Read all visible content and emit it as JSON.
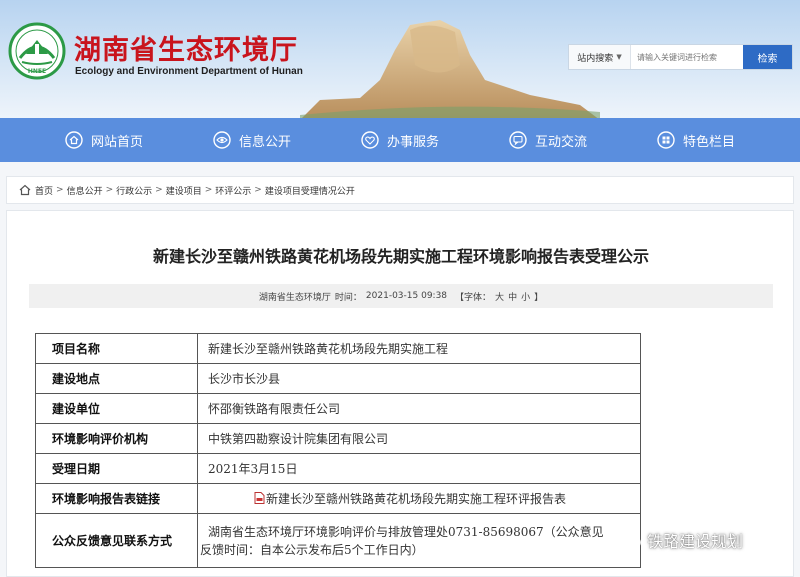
{
  "header": {
    "title": "湖南省生态环境厅",
    "subtitle": "Ecology and Environment Department of Hunan",
    "logo_text": "HNEE"
  },
  "search": {
    "scope_label": "站内搜索",
    "placeholder": "请输入关键词进行检索",
    "button_label": "检索"
  },
  "nav": {
    "items": [
      {
        "label": "网站首页",
        "icon": "home-icon"
      },
      {
        "label": "信息公开",
        "icon": "eye-icon"
      },
      {
        "label": "办事服务",
        "icon": "heart-icon"
      },
      {
        "label": "互动交流",
        "icon": "chat-icon"
      },
      {
        "label": "特色栏目",
        "icon": "grid-icon"
      }
    ]
  },
  "breadcrumb": [
    "首页",
    "信息公开",
    "行政公示",
    "建设项目",
    "环评公示",
    "建设项目受理情况公开"
  ],
  "article": {
    "title": "新建长沙至赣州铁路黄花机场段先期实施工程环境影响报告表受理公示",
    "source": "湖南省生态环境厅",
    "time_label": "时间：",
    "time": "2021-03-15 09:38",
    "font_label": "【字体：",
    "font_large": "大",
    "font_medium": "中",
    "font_small": "小",
    "font_close": "】"
  },
  "table": {
    "rows": [
      {
        "key": "项目名称",
        "value": "新建长沙至赣州铁路黄花机场段先期实施工程"
      },
      {
        "key": "建设地点",
        "value": "长沙市长沙县"
      },
      {
        "key": "建设单位",
        "value": "怀邵衡铁路有限责任公司"
      },
      {
        "key": "环境影响评价机构",
        "value": "中铁第四勘察设计院集团有限公司"
      },
      {
        "key": "受理日期",
        "value": "2021年3月15日"
      },
      {
        "key": "环境影响报告表链接",
        "value": "新建长沙至赣州铁路黄花机场段先期实施工程环评报告表"
      },
      {
        "key": "公众反馈意见联系方式",
        "value_line1": "湖南省生态环境厅环境影响评价与排放管理处0731-85698067（公众意见",
        "value_line2": "反馈时间：自本公示发布后5个工作日内）"
      }
    ]
  },
  "watermark": "铁路建设规划",
  "colors": {
    "accent": "#5a8ede",
    "title_red": "#c9141d",
    "search_button": "#2e6bc5"
  }
}
